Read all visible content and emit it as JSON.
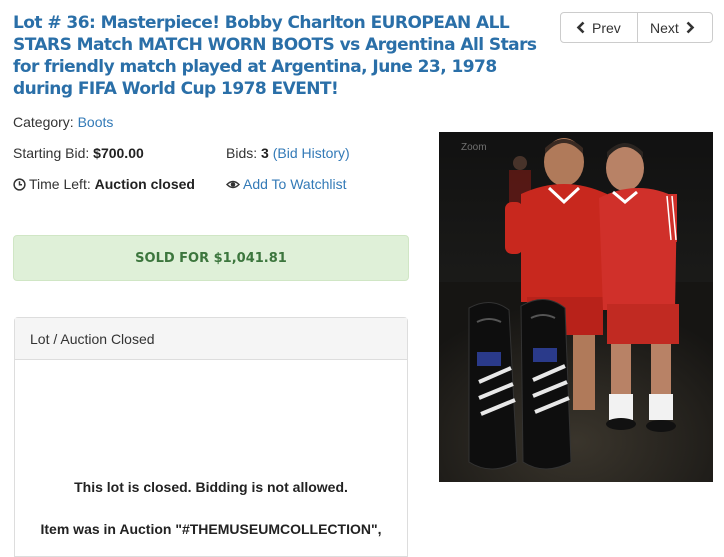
{
  "lot": {
    "title": "Lot # 36: Masterpiece! Bobby Charlton EUROPEAN ALL STARS Match MATCH WORN BOOTS vs Argentina All Stars for friendly match played at Argentina, June 23, 1978 during FIFA World Cup 1978 EVENT!"
  },
  "pager": {
    "prev_label": "Prev",
    "next_label": "Next"
  },
  "details": {
    "category_label": "Category:",
    "category_value": "Boots",
    "starting_bid_label": "Starting Bid:",
    "starting_bid_value": "$700.00",
    "bids_label": "Bids:",
    "bids_value": "3",
    "bid_history_link": "(Bid History)",
    "time_left_label": "Time Left:",
    "time_left_value": "Auction closed",
    "watchlist_link": "Add To Watchlist"
  },
  "sold_banner": "SOLD FOR $1,041.81",
  "panel": {
    "heading": "Lot / Auction Closed",
    "message": "This lot is closed. Bidding is not allowed.",
    "auction_line": "Item was in Auction \"#THEMUSEUMCOLLECTION\","
  },
  "image": {
    "zoom_label": "Zoom"
  },
  "colors": {
    "title_blue": "#2a6fa8",
    "link_blue": "#337ab7",
    "sold_bg": "#dff0d8",
    "sold_text": "#3c763d",
    "kit_red": "#c8281e"
  },
  "icons": {
    "prev": "chevron-left-icon",
    "next": "chevron-right-icon",
    "time": "clock-icon",
    "watch": "eye-icon"
  }
}
